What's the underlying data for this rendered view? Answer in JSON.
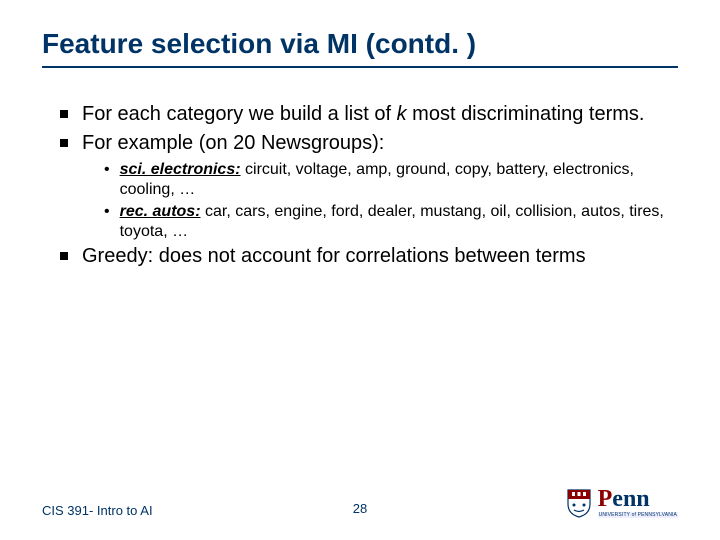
{
  "title": "Feature selection via MI (contd. )",
  "bullets": {
    "b0": "For each category we build a list of ",
    "b0_k": "k",
    "b0_tail": " most discriminating terms.",
    "b1": "For example (on 20 Newsgroups):",
    "s0_label": "sci. electronics:",
    "s0_text": " circuit, voltage, amp, ground, copy, battery, electronics, cooling, …",
    "s1_label": "rec. autos:",
    "s1_text": " car, cars, engine, ford, dealer, mustang, oil, collision, autos, tires, toyota, …",
    "b2": "Greedy: does not account for correlations between terms"
  },
  "footer": {
    "left": "CIS 391- Intro to AI",
    "page": "28",
    "logo": {
      "p": "P",
      "enn": "enn",
      "sub": "UNIVERSITY of PENNSYLVANIA"
    }
  }
}
